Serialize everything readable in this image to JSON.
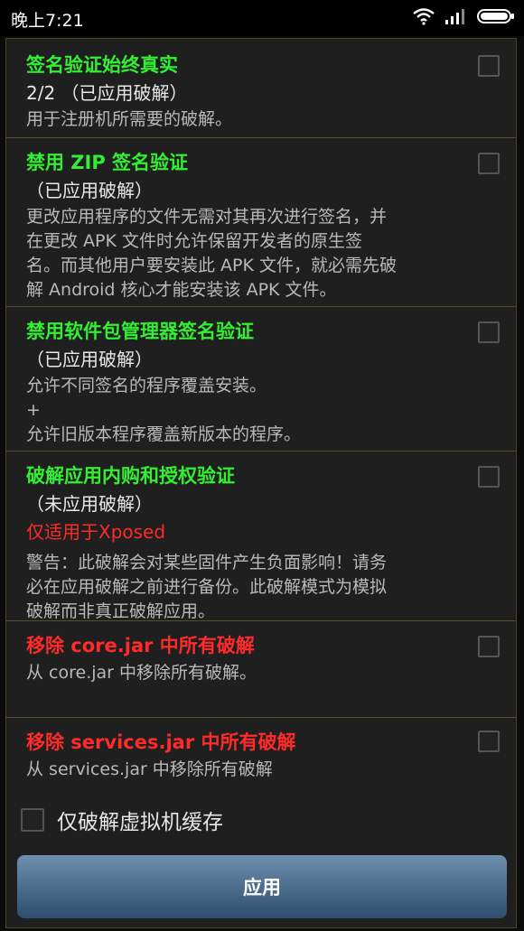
{
  "status_bar": {
    "time": "晚上7:21"
  },
  "options": [
    {
      "title": "签名验证始终真实",
      "title_color": "#33ee33",
      "status": "2/2 （已应用破解）",
      "warning": "",
      "description": "用于注册机所需要的破解。",
      "checked": false
    },
    {
      "title": "禁用 ZIP 签名验证",
      "title_color": "#33ee33",
      "status": "（已应用破解）",
      "warning": "",
      "description": "更改应用程序的文件无需对其再次进行签名，并\n在更改 APK 文件时允许保留开发者的原生签\n名。而其他用户要安装此 APK 文件，就必需先破\n解 Android 核心才能安装该 APK 文件。",
      "checked": false
    },
    {
      "title": "禁用软件包管理器签名验证",
      "title_color": "#33ee33",
      "status": "（已应用破解）",
      "warning": "",
      "description": "允许不同签名的程序覆盖安装。\n+\n允许旧版本程序覆盖新版本的程序。",
      "checked": false
    },
    {
      "title": "破解应用内购和授权验证",
      "title_color": "#33ee33",
      "status": "（未应用破解）",
      "warning": "仅适用于Xposed",
      "description": "警告：此破解会对某些固件产生负面影响！请务\n必在应用破解之前进行备份。此破解模式为模拟\n破解而非真正破解应用。",
      "checked": false
    },
    {
      "title": "移除 core.jar 中所有破解",
      "title_color": "#ff2a2a",
      "status": "",
      "warning": "",
      "description": "从 core.jar 中移除所有破解。",
      "checked": false
    },
    {
      "title": "移除 services.jar 中所有破解",
      "title_color": "#ff2a2a",
      "status": "",
      "warning": "",
      "description": "从 services.jar 中移除所有破解",
      "checked": false
    }
  ],
  "vm_cache": {
    "label": "仅破解虚拟机缓存",
    "checked": false
  },
  "apply_button": {
    "label": "应用"
  }
}
